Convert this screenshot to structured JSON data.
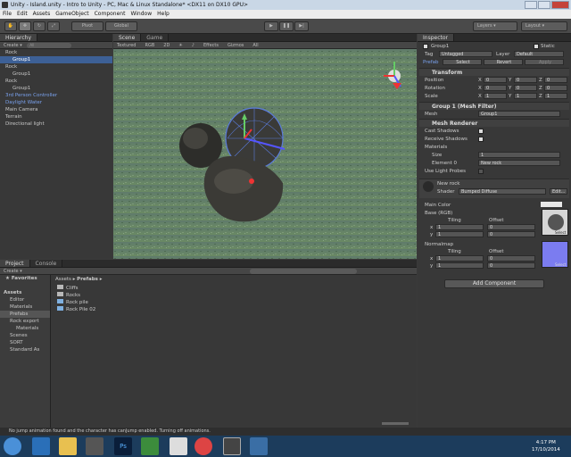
{
  "window": {
    "title": "Unity - Island.unity - Intro to Unity - PC, Mac & Linux Standalone* <DX11 on DX10 GPU>"
  },
  "menu": [
    "File",
    "Edit",
    "Assets",
    "GameObject",
    "Component",
    "Window",
    "Help"
  ],
  "toolbar": {
    "pivot": "Pivot",
    "global": "Global",
    "layers": "Layers",
    "layout": "Layout"
  },
  "hierarchy": {
    "tab": "Hierarchy",
    "create": "Create",
    "search": "All",
    "items": [
      {
        "label": "Rock",
        "indent": 0,
        "color": "normal"
      },
      {
        "label": "Group1",
        "indent": 1,
        "color": "normal",
        "selected": true
      },
      {
        "label": "Rock",
        "indent": 0,
        "color": "normal"
      },
      {
        "label": "Group1",
        "indent": 1,
        "color": "normal"
      },
      {
        "label": "Rock",
        "indent": 0,
        "color": "normal"
      },
      {
        "label": "Group1",
        "indent": 1,
        "color": "normal"
      },
      {
        "label": "3rd Person Controller",
        "indent": 0,
        "color": "blue"
      },
      {
        "label": "Daylight Water",
        "indent": 0,
        "color": "blue"
      },
      {
        "label": "Main Camera",
        "indent": 0,
        "color": "normal"
      },
      {
        "label": "Terrain",
        "indent": 0,
        "color": "normal"
      },
      {
        "label": "Directional light",
        "indent": 0,
        "color": "normal"
      }
    ]
  },
  "scene": {
    "tabs": [
      "Scene",
      "Game"
    ],
    "shading": "Textured",
    "rgb": "RGB",
    "mode2d": "2D",
    "effects": "Effects",
    "gizmos": "Gizmos",
    "search": "All"
  },
  "inspector": {
    "tab": "Inspector",
    "name": "Group1",
    "static": "Static",
    "tag_label": "Tag",
    "tag_value": "Untagged",
    "layer_label": "Layer",
    "layer_value": "Default",
    "prefab_label": "Prefab",
    "prefab_select": "Select",
    "prefab_revert": "Revert",
    "prefab_apply": "Apply",
    "transform": {
      "title": "Transform",
      "position": "Position",
      "rotation": "Rotation",
      "scale": "Scale",
      "pos": [
        "0",
        "0",
        "0"
      ],
      "rot": [
        "0",
        "0",
        "0"
      ],
      "scl": [
        "1",
        "1",
        "1"
      ],
      "axes": [
        "X",
        "Y",
        "Z"
      ]
    },
    "mesh_filter": {
      "title": "Group 1 (Mesh Filter)",
      "mesh_label": "Mesh",
      "mesh_value": "Group1"
    },
    "mesh_renderer": {
      "title": "Mesh Renderer",
      "cast": "Cast Shadows",
      "receive": "Receive Shadows",
      "materials": "Materials",
      "size_label": "Size",
      "size_value": "1",
      "element_label": "Element 0",
      "element_value": "New rock",
      "probes": "Use Light Probes"
    },
    "material": {
      "name": "New rock",
      "shader_label": "Shader",
      "shader_value": "Bumped Diffuse",
      "edit": "Edit...",
      "main_color": "Main Color",
      "base": "Base (RGB)",
      "normalmap": "Normalmap",
      "tiling": "Tiling",
      "offset": "Offset",
      "x": "x",
      "y": "y",
      "base_tiling": [
        "1",
        "1"
      ],
      "base_offset": [
        "0",
        "0"
      ],
      "nm_tiling": [
        "1",
        "1"
      ],
      "nm_offset": [
        "0",
        "0"
      ],
      "select": "Select"
    },
    "add_component": "Add Component"
  },
  "project": {
    "tabs": [
      "Project",
      "Console"
    ],
    "create": "Create",
    "favorites": "Favorites",
    "tree": [
      {
        "label": "Assets",
        "indent": 0,
        "bold": true
      },
      {
        "label": "Editor",
        "indent": 1
      },
      {
        "label": "Materials",
        "indent": 1
      },
      {
        "label": "Prefabs",
        "indent": 1,
        "selected": true
      },
      {
        "label": "Rock export",
        "indent": 1
      },
      {
        "label": "Materials",
        "indent": 2
      },
      {
        "label": "Scenes",
        "indent": 1
      },
      {
        "label": "SORT",
        "indent": 1
      },
      {
        "label": "Standard As",
        "indent": 1
      }
    ],
    "breadcrumb": [
      "Assets",
      "Prefabs"
    ],
    "files": [
      {
        "label": "Cliffs",
        "type": "folder"
      },
      {
        "label": "Rocks",
        "type": "folder"
      },
      {
        "label": "Rock pile",
        "type": "prefab"
      },
      {
        "label": "Rock Pile 02",
        "type": "prefab"
      }
    ]
  },
  "status": {
    "message": "No jump animation found and the character has canJump enabled. Turning off animations."
  },
  "taskbar": {
    "time": "4:17 PM",
    "date": "17/10/2014"
  }
}
